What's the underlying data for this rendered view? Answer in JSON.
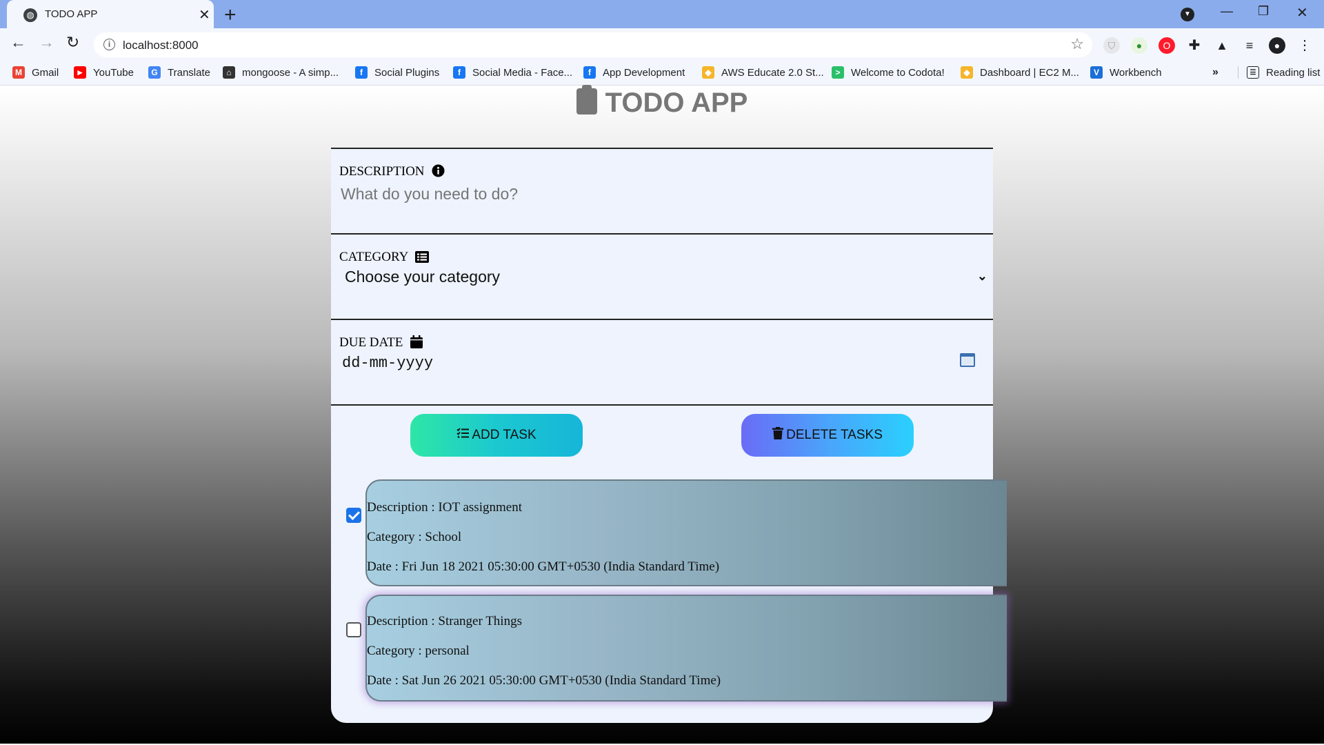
{
  "browser": {
    "tab_title": "TODO APP",
    "url": "localhost:8000",
    "bookmarks": [
      {
        "label": "Gmail",
        "icon": "gmail-icon",
        "color": "#ea4335",
        "glyph": "M"
      },
      {
        "label": "YouTube",
        "icon": "youtube-icon",
        "color": "#ff0000",
        "glyph": "▶"
      },
      {
        "label": "Translate",
        "icon": "translate-icon",
        "color": "#4285f4",
        "glyph": "G"
      },
      {
        "label": "mongoose - A simp...",
        "icon": "mongoose-icon",
        "color": "#333333",
        "glyph": "⌂"
      },
      {
        "label": "Social Plugins",
        "icon": "facebook-icon",
        "color": "#1877f2",
        "glyph": "f"
      },
      {
        "label": "Social Media - Face...",
        "icon": "facebook-icon",
        "color": "#1877f2",
        "glyph": "f"
      },
      {
        "label": "App Development",
        "icon": "facebook-icon",
        "color": "#1877f2",
        "glyph": "f"
      },
      {
        "label": "AWS Educate 2.0 St...",
        "icon": "aws-icon",
        "color": "#f6b52a",
        "glyph": "◆"
      },
      {
        "label": "Welcome to Codota!",
        "icon": "codota-icon",
        "color": "#2bbf6a",
        "glyph": ">"
      },
      {
        "label": "Dashboard | EC2 M...",
        "icon": "aws-icon",
        "color": "#f6b52a",
        "glyph": "◆"
      },
      {
        "label": "Workbench",
        "icon": "workbench-icon",
        "color": "#1a6fd8",
        "glyph": "V"
      }
    ],
    "more_bookmarks": "»",
    "reading_list": "Reading list"
  },
  "app": {
    "title": "TODO APP",
    "description_label": "DESCRIPTION",
    "description_placeholder": "What do you need to do?",
    "category_label": "CATEGORY",
    "category_selected": "Choose your category",
    "due_date_label": "DUE DATE",
    "due_date_placeholder": "dd-mm-yyyy",
    "add_button": "ADD TASK",
    "delete_button": "DELETE TASKS"
  },
  "tasks": [
    {
      "checked": true,
      "description": "Description : IOT assignment",
      "category": "Category : School",
      "date": "Date : Fri Jun 18 2021 05:30:00 GMT+0530 (India Standard Time)"
    },
    {
      "checked": false,
      "description": "Description : Stranger Things",
      "category": "Category : personal",
      "date": "Date : Sat Jun 26 2021 05:30:00 GMT+0530 (India Standard Time)"
    }
  ],
  "colors": {
    "add_gradient_start": "#2ee6a6",
    "delete_gradient_start": "#6a6cf6",
    "checkbox_checked": "#1a73e8"
  }
}
